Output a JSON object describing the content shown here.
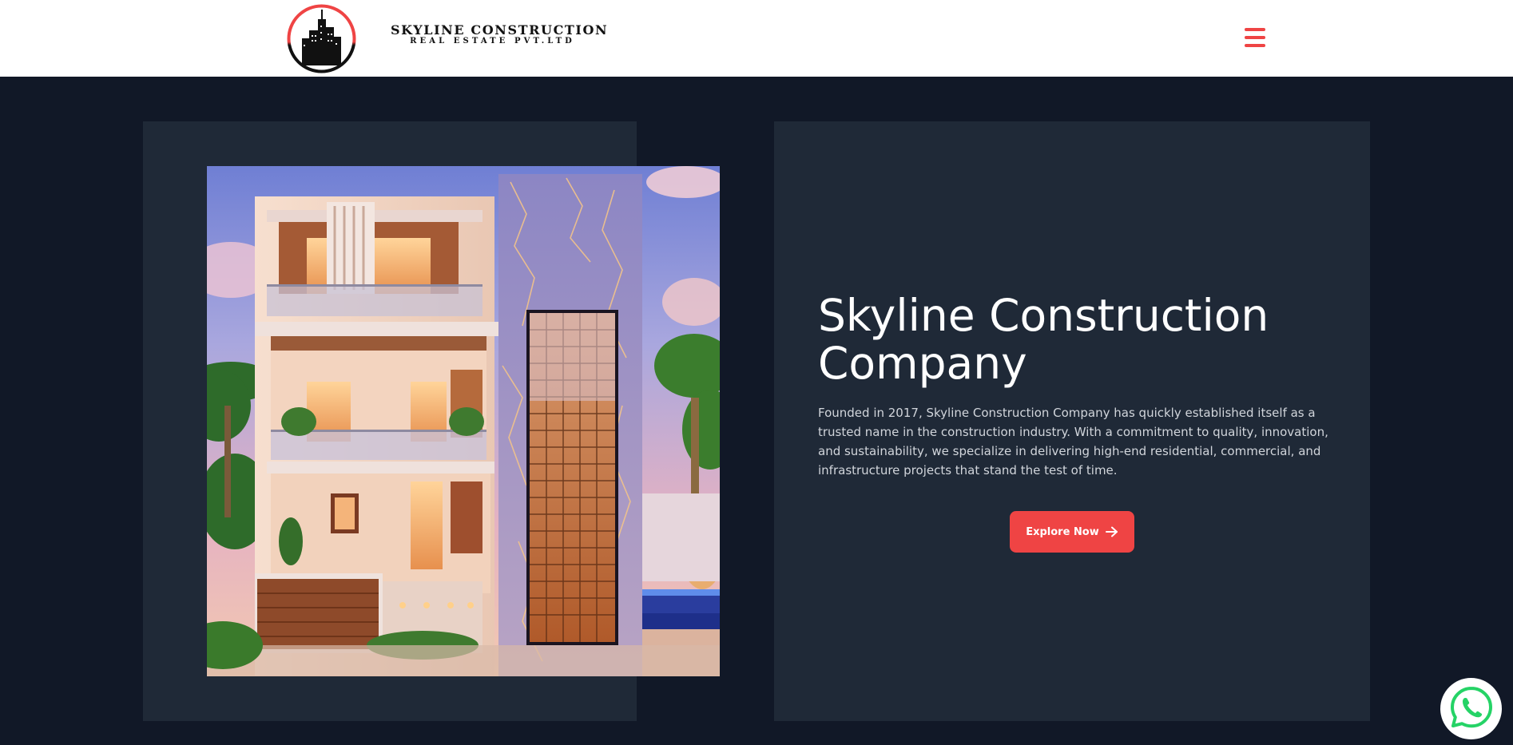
{
  "header": {
    "brand_line1": "SKYLINE CONSTRUCTION",
    "brand_line2": "REAL ESTATE PVT.LTD",
    "logo_icon": "skyline-buildings-logo-icon",
    "menu_icon": "hamburger-menu-icon"
  },
  "hero": {
    "image_description": "modern-luxury-house",
    "title": "Skyline Construction Company",
    "description": "Founded in 2017, Skyline Construction Company has quickly established itself as a trusted name in the construction industry. With a commitment to quality, innovation, and sustainability, we specialize in delivering high-end residential, commercial, and infrastructure projects that stand the test of time.",
    "cta_label": "Explore Now",
    "cta_icon": "arrow-right-icon"
  },
  "floating": {
    "whatsapp_icon": "whatsapp-icon"
  },
  "colors": {
    "accent": "#ef4444",
    "background": "#111827",
    "panel": "#1f2937",
    "header_bg": "#ffffff",
    "whatsapp_green": "#25d366"
  }
}
